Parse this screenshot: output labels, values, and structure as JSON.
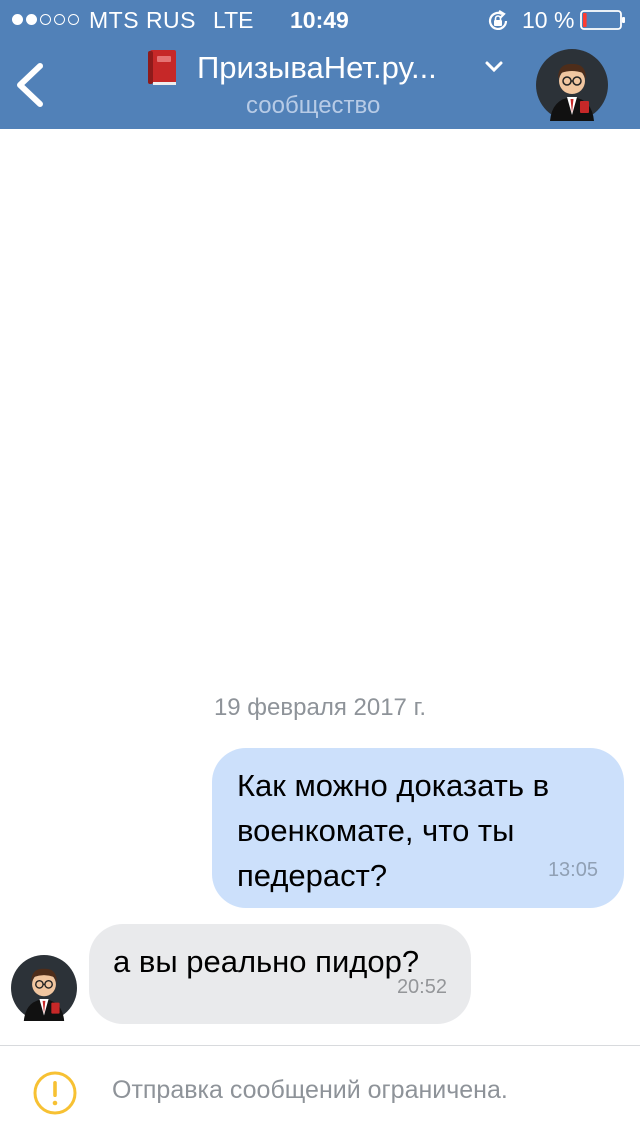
{
  "status_bar": {
    "carrier": "MTS RUS",
    "network": "LTE",
    "time": "10:49",
    "battery": "10 %",
    "signal_bars_filled": 2,
    "signal_bars_total": 5,
    "battery_level": 0.1
  },
  "header": {
    "title": "ПризываНет.ру...",
    "subtitle": "сообщество",
    "back_icon": "chevron-left-icon",
    "title_icon": "red-book-icon",
    "dropdown_icon": "chevron-down-icon"
  },
  "chat": {
    "date_separator": "19 февраля 2017 г.",
    "messages": [
      {
        "direction": "outgoing",
        "lines": [
          "Как можно доказать в",
          "военкомате, что ты",
          "педераст?"
        ],
        "time": "13:05"
      },
      {
        "direction": "incoming",
        "lines": [
          "а вы реально пидор?"
        ],
        "time": "20:52"
      }
    ]
  },
  "footer": {
    "notice": "Отправка сообщений ограничена.",
    "icon": "warning-icon"
  },
  "colors": {
    "header_bg": "#5181b8",
    "outgoing_bubble": "#cce0fb",
    "incoming_bubble": "#e9eaec",
    "warning": "#f7c133"
  }
}
